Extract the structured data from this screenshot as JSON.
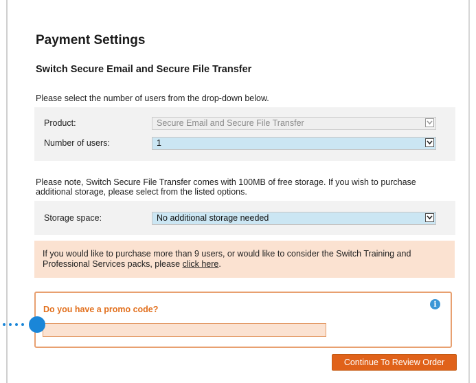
{
  "page": {
    "title": "Payment Settings",
    "section_title": "Switch Secure Email and Secure File Transfer",
    "intro": "Please select the number of users from the drop-down below."
  },
  "product_form": {
    "product_label": "Product:",
    "product_value": "Secure Email and Secure File Transfer",
    "users_label": "Number of users:",
    "users_value": "1"
  },
  "storage": {
    "note_line1": "Please note, Switch Secure File Transfer comes with 100MB of free storage. If you wish to purchase",
    "note_line2": "additional storage, please select from the listed options.",
    "label": "Storage space:",
    "value": "No additional storage needed"
  },
  "banner": {
    "text_line1": "If you would like to purchase more than 9 users, or would like to consider the Switch Training and",
    "text_line2_prefix": "Professional Services packs, please ",
    "link_label": "click here",
    "text_line2_suffix": "."
  },
  "promo": {
    "title": "Do you have a promo code?",
    "input_value": "",
    "info_icon": "info-icon"
  },
  "actions": {
    "continue_label": "Continue To Review Order"
  },
  "colors": {
    "accent_orange": "#e0621a",
    "select_blue": "#cbe6f3",
    "banner_peach": "#fbe2d1",
    "info_blue": "#3a96d6"
  }
}
